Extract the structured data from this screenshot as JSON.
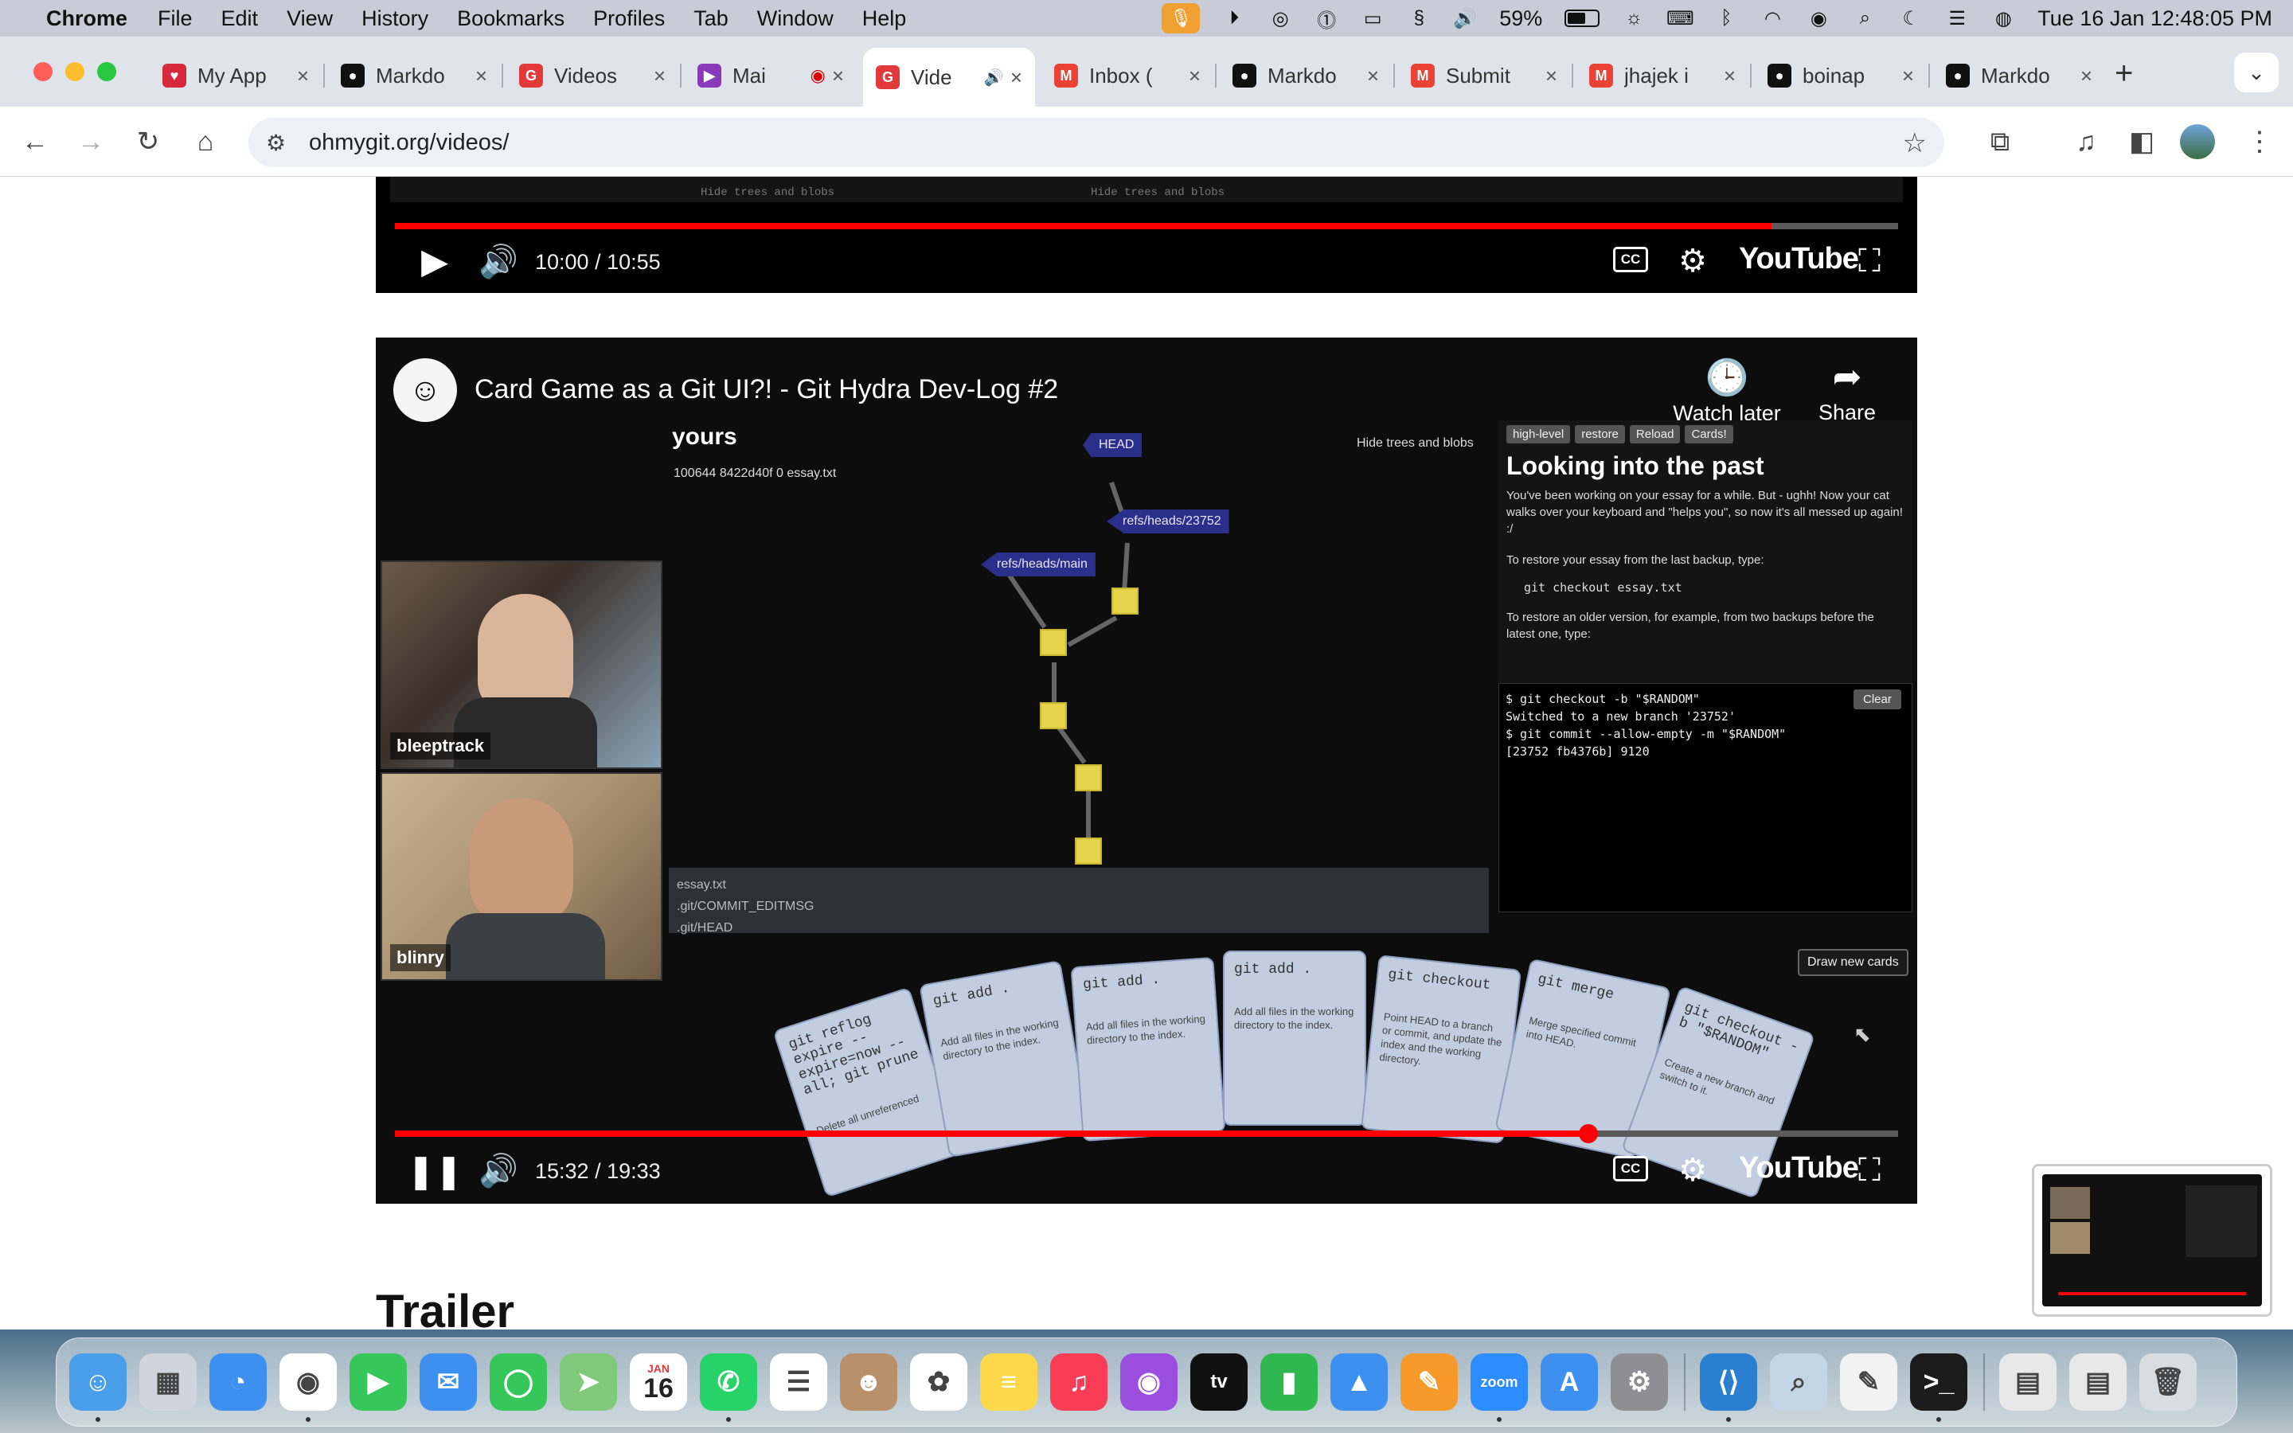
{
  "menubar": {
    "app_name": "Chrome",
    "menus": [
      "File",
      "Edit",
      "View",
      "History",
      "Bookmarks",
      "Profiles",
      "Tab",
      "Window",
      "Help"
    ],
    "battery": "59%",
    "datetime": "Tue 16 Jan  12:48:05 PM"
  },
  "tabs": [
    {
      "label": "My App",
      "favicon_color": "#d8283c",
      "favicon_icon": "heart-icon"
    },
    {
      "label": "Markdo",
      "favicon_color": "#111111",
      "favicon_icon": "github-icon"
    },
    {
      "label": "Videos",
      "favicon_color": "#e23a3a",
      "favicon_icon": "git-icon"
    },
    {
      "label": "Mai",
      "favicon_color": "#8a3ab9",
      "favicon_icon": "play-icon"
    },
    {
      "label": "Vide",
      "favicon_color": "#e23a3a",
      "favicon_icon": "git-icon"
    },
    {
      "label": "Inbox (",
      "favicon_color": "#ea4335",
      "favicon_icon": "gmail-icon"
    },
    {
      "label": "Markdo",
      "favicon_color": "#111111",
      "favicon_icon": "github-icon"
    },
    {
      "label": "Submit",
      "favicon_color": "#ea4335",
      "favicon_icon": "gmail-icon"
    },
    {
      "label": "jhajek i",
      "favicon_color": "#ea4335",
      "favicon_icon": "gmail-icon"
    },
    {
      "label": "boinap",
      "favicon_color": "#111111",
      "favicon_icon": "github-icon"
    },
    {
      "label": "Markdo",
      "favicon_color": "#111111",
      "favicon_icon": "github-icon"
    }
  ],
  "toolbar": {
    "url": "ohmygit.org/videos/"
  },
  "video1": {
    "time": "10:00 / 10:55",
    "progress": 0.916,
    "partial_text_left": "Hide trees and blobs",
    "partial_text_right": "Hide trees and blobs",
    "logo": "YouTube",
    "cc": "CC"
  },
  "video2": {
    "title": "Card Game as a Git UI?! - Git Hydra Dev-Log #2",
    "watch_later": "Watch later",
    "share": "Share",
    "time": "15:32 / 19:33",
    "progress": 0.794,
    "logo": "YouTube",
    "cc": "CC",
    "webcams": [
      {
        "name": "bleeptrack"
      },
      {
        "name": "blinry"
      }
    ],
    "graph": {
      "heading": "yours",
      "file_line": "100644 8422d40f 0 essay.txt",
      "hide_option": "Hide trees and blobs",
      "refs": [
        "HEAD",
        "refs/heads/23752",
        "refs/heads/main"
      ],
      "files": [
        "essay.txt",
        ".git/COMMIT_EDITMSG",
        ".git/HEAD"
      ]
    },
    "panel": {
      "buttons": [
        "high-level",
        "restore",
        "Reload",
        "Cards!"
      ],
      "heading": "Looking into the past",
      "para1": "You've been working on your essay for a while. But - ughh! Now your cat walks over your keyboard and \"helps you\", so now it's all messed up again! :/",
      "para2": "To restore your essay from the last backup, type:",
      "code": "git checkout essay.txt",
      "para3": "To restore an older version, for example, from two backups before the latest one, type:"
    },
    "terminal": {
      "lines": [
        "$ git checkout -b \"$RANDOM\"",
        "Switched to a new branch '23752'",
        "$ git commit --allow-empty -m \"$RANDOM\"",
        "[23752 fb4376b] 9120"
      ],
      "clear": "Clear"
    },
    "draw_button": "Draw new cards",
    "cards": [
      {
        "cmd": "git reflog expire --expire=now --all; git prune",
        "desc": "Delete all unreferenced"
      },
      {
        "cmd": "git add .",
        "desc": "Add all files in the working directory to the index."
      },
      {
        "cmd": "git add .",
        "desc": "Add all files in the working directory to the index."
      },
      {
        "cmd": "git add .",
        "desc": "Add all files in the working directory to the index."
      },
      {
        "cmd": "git checkout",
        "desc": "Point HEAD to a branch or commit, and update the index and the working directory."
      },
      {
        "cmd": "git merge",
        "desc": "Merge specified commit into HEAD."
      },
      {
        "cmd": "git checkout -b \"$RANDOM\"",
        "desc": "Create a new branch and switch to it."
      }
    ]
  },
  "section_heading": "Trailer",
  "dock": {
    "calendar_month": "JAN",
    "calendar_day": "16",
    "zoom_label": "zoom",
    "tv_label": "tv",
    "apps": [
      "finder-icon",
      "launchpad-icon",
      "safari-icon",
      "chrome-icon",
      "facetime-icon",
      "mail-icon",
      "messages-icon",
      "maps-icon",
      "calendar-icon",
      "whatsapp-icon",
      "reminders-icon",
      "contacts-icon",
      "photos-icon",
      "notes-icon",
      "music-icon",
      "podcasts-icon",
      "appletv-icon",
      "numbers-icon",
      "keynote-icon",
      "pages-icon",
      "zoom-icon",
      "appstore-icon",
      "settings-icon",
      "vscode-icon",
      "preview-icon",
      "textedit-icon",
      "terminal-icon",
      "pdf-doc-icon",
      "document-icon",
      "trash-icon"
    ]
  }
}
